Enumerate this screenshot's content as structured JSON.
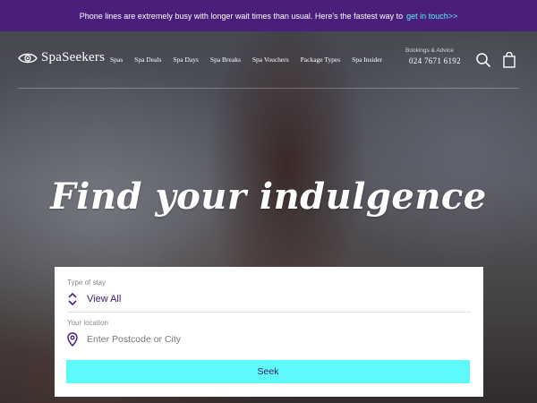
{
  "announcement": {
    "text": "Phone lines are extremely busy with longer wait times than usual. Here's the fastest way to",
    "link": "get in touch>>"
  },
  "header": {
    "logo_text": "SpaSeekers",
    "menu": [
      "Spas",
      "Spa Deals",
      "Spa Days",
      "Spa Breaks",
      "Spa Vouchers",
      "Package Types",
      "Spa Insider"
    ],
    "contact_label": "Bookings & Advice",
    "contact_phone": "024 7671 6192",
    "icons": {
      "search": "search-icon",
      "bag": "bag-icon",
      "logo": "eye-logo-icon"
    }
  },
  "hero": {
    "headline": "Find your indulgence"
  },
  "search_form": {
    "stay_label": "Type of stay",
    "stay_value": "View All",
    "location_label": "Your location",
    "location_placeholder": "Enter Postcode or City",
    "submit_label": "Seek",
    "icons": {
      "stay": "chevron-updown-icon",
      "location": "location-pin-icon"
    }
  },
  "colors": {
    "announcement_bg": "#4a1f7c",
    "link": "#5cf2f6",
    "accent_text": "#3b1a6b",
    "button_bg": "#5ef9fb"
  }
}
